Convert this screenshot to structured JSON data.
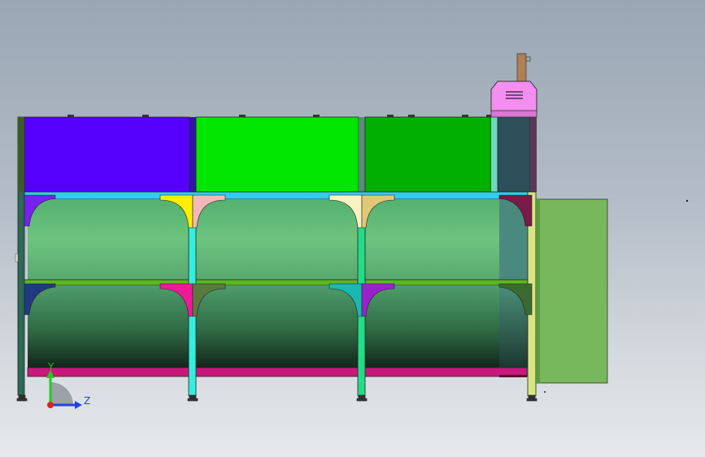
{
  "viewport": {
    "triad": {
      "y_label": "Y",
      "z_label": "Z"
    },
    "colors": {
      "panel_blue": "#5500ff",
      "panel_green_light": "#00e600",
      "panel_green_dark": "#00b000",
      "rail_cyan": "#33ccee",
      "base_magenta": "#c8187c",
      "enclosure_green": "#78b85c",
      "pink_unit": "#f48ef0"
    }
  }
}
